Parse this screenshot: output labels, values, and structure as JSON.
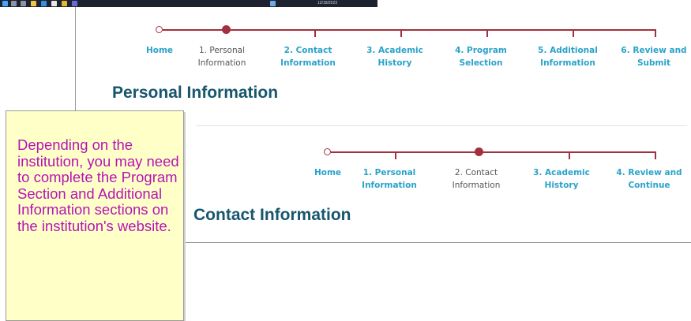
{
  "taskbar": {
    "icons": [
      "windows-icon",
      "search-icon",
      "task-view-icon",
      "explorer-icon",
      "store-icon",
      "mail-icon",
      "chrome-icon",
      "teams-icon"
    ],
    "tray_text": "12/18/2023"
  },
  "main_stepper": {
    "steps": [
      {
        "label": "Home"
      },
      {
        "label": "1. Personal\nInformation"
      },
      {
        "label": "2. Contact\nInformation"
      },
      {
        "label": "3. Academic\nHistory"
      },
      {
        "label": "4. Program\nSelection"
      },
      {
        "label": "5. Additional\nInformation"
      },
      {
        "label": "6. Review and\nSubmit"
      }
    ],
    "current_index": 1
  },
  "main_heading": "Personal Information",
  "second_stepper": {
    "steps": [
      {
        "label": "Home"
      },
      {
        "label": "1. Personal\nInformation"
      },
      {
        "label": "2. Contact\nInformation"
      },
      {
        "label": "3. Academic\nHistory"
      },
      {
        "label": "4. Review and\nContinue"
      }
    ],
    "current_index": 2
  },
  "second_heading": "Contact Information",
  "callout": {
    "text": "Depending on the institution, you may need to complete the Program Section and Additional Information sections on the institution's website."
  },
  "colors": {
    "track": "#a2303e",
    "link": "#29a3c9",
    "current": "#555555",
    "heading": "#17566d",
    "callout_bg": "#ffffc8",
    "callout_text": "#b514b5"
  }
}
